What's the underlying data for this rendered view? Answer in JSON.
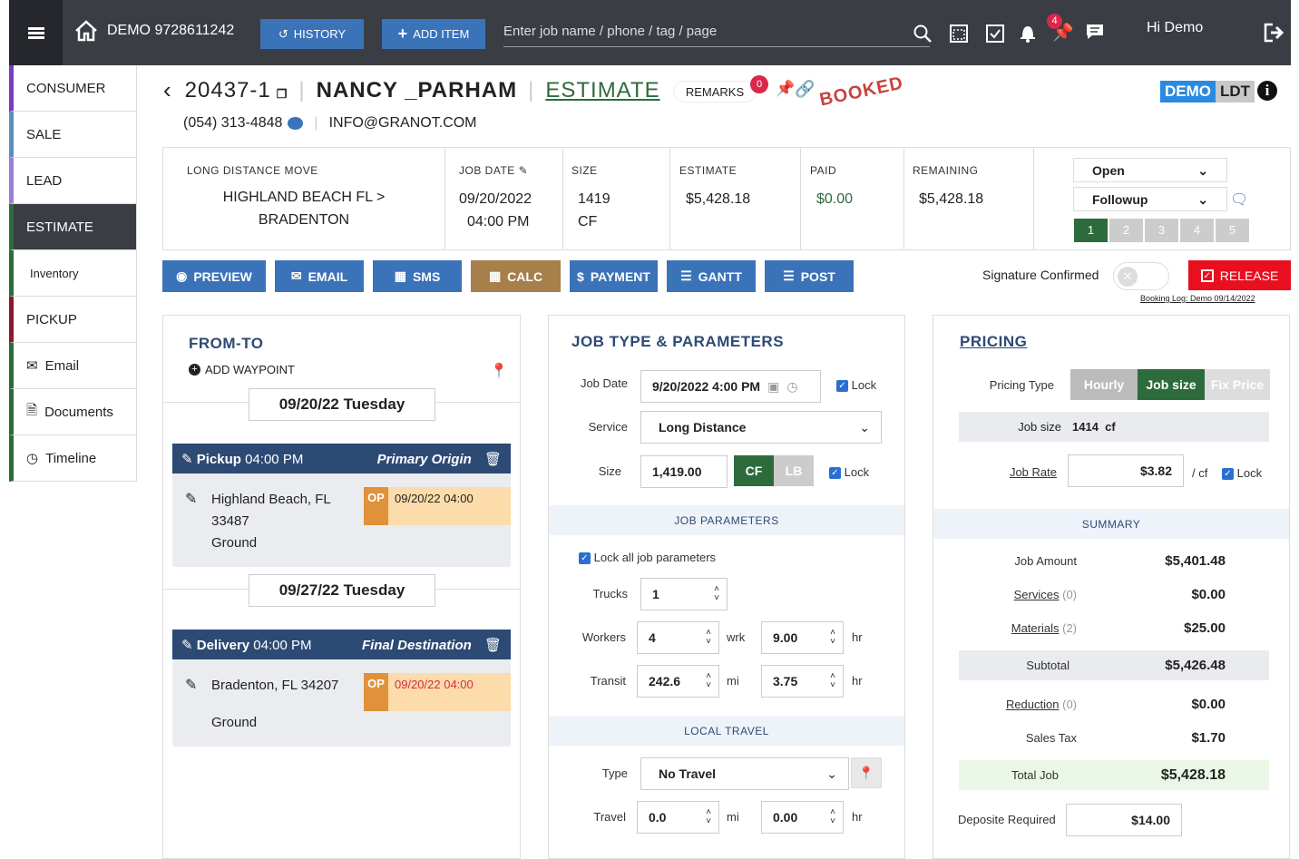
{
  "topbar": {
    "account": "DEMO 9728611242",
    "history_label": "HISTORY",
    "add_item_label": "ADD ITEM",
    "search_placeholder": "Enter job name / phone / tag / page",
    "notif_count": "4",
    "greeting": "Hi Demo"
  },
  "sidebar": {
    "items": [
      {
        "label": "CONSUMER",
        "color": "#7a3bbf"
      },
      {
        "label": "SALE",
        "color": "#5a8fc0"
      },
      {
        "label": "LEAD",
        "color": "#9b7fd4"
      },
      {
        "label": "ESTIMATE",
        "color": "#2e6b3c"
      },
      {
        "label": "Inventory",
        "color": "#2e6b3c"
      },
      {
        "label": "PICKUP",
        "color": "#8a1a2a"
      },
      {
        "label": "Email",
        "color": "#2e6b3c"
      },
      {
        "label": "Documents",
        "color": "#2e6b3c"
      },
      {
        "label": "Timeline",
        "color": "#2e6b3c"
      }
    ]
  },
  "job": {
    "number": "20437-1",
    "name": "NANCY _PARHAM",
    "status": "ESTIMATE",
    "remarks_label": "REMARKS",
    "remarks_count": "0",
    "booked_stamp": "BOOKED",
    "phone": "(054) 313-4848",
    "email": "INFO@GRANOT.COM",
    "badge_demo": "DEMO",
    "badge_ldt": "LDT"
  },
  "summary": {
    "move_type": "LONG DISTANCE MOVE",
    "route_line1": "HIGHLAND BEACH FL >",
    "route_line2": "BRADENTON",
    "job_date_label": "JOB DATE",
    "job_date": "09/20/2022",
    "job_time": "04:00 PM",
    "size_label": "SIZE",
    "size_value": "1419",
    "size_unit": "CF",
    "estimate_label": "ESTIMATE",
    "estimate_value": "$5,428.18",
    "paid_label": "PAID",
    "paid_value": "$0.00",
    "remaining_label": "REMAINING",
    "remaining_value": "$5,428.18",
    "status_select": "Open",
    "followup_select": "Followup",
    "steps": [
      "1",
      "2",
      "3",
      "4",
      "5"
    ]
  },
  "actions": {
    "preview": "PREVIEW",
    "email": "EMAIL",
    "sms": "SMS",
    "calc": "CALC",
    "payment": "PAYMENT",
    "gantt": "GANTT",
    "post": "POST",
    "signature_label": "Signature Confirmed",
    "release": "RELEASE",
    "booking_log": "Booking Log: Demo 09/14/2022"
  },
  "fromto": {
    "title": "FROM-TO",
    "add_waypoint": "ADD WAYPOINT",
    "stops": [
      {
        "date": "09/20/22 Tuesday",
        "type": "Pickup",
        "time": "04:00 PM",
        "role": "Primary Origin",
        "addr1": "Highland Beach, FL",
        "addr2": "33487",
        "level": "Ground",
        "op": "OP",
        "op_time": "09/20/22 04:00"
      },
      {
        "date": "09/27/22 Tuesday",
        "type": "Delivery",
        "time": "04:00 PM",
        "role": "Final Destination",
        "addr1": "Bradenton, FL 34207",
        "addr2": "",
        "level": "Ground",
        "op": "OP",
        "op_time": "09/20/22 04:00"
      }
    ]
  },
  "params": {
    "title": "JOB TYPE & PARAMETERS",
    "job_date_label": "Job Date",
    "job_date_value": "9/20/2022 4:00 PM",
    "lock": "Lock",
    "service_label": "Service",
    "service_value": "Long Distance",
    "size_label": "Size",
    "size_value": "1,419.00",
    "cf": "CF",
    "lb": "LB",
    "section_job": "JOB PARAMETERS",
    "lock_all": "Lock all job parameters",
    "trucks_label": "Trucks",
    "trucks_value": "1",
    "workers_label": "Workers",
    "workers_value": "4",
    "wrk": "wrk",
    "workers_hr": "9.00",
    "hr": "hr",
    "transit_label": "Transit",
    "transit_value": "242.6",
    "mi": "mi",
    "transit_hr": "3.75",
    "section_travel": "LOCAL TRAVEL",
    "type_label": "Type",
    "type_value": "No Travel",
    "travel_label": "Travel",
    "travel_value": "0.0",
    "travel_hr": "0.00"
  },
  "pricing": {
    "title": "PRICING",
    "type_label": "Pricing Type",
    "opt_hourly": "Hourly",
    "opt_jobsize": "Job size",
    "opt_fix": "Fix Price",
    "job_size_label": "Job size",
    "job_size_value": "1414  cf",
    "job_rate_label": "Job Rate",
    "job_rate_value": "$3.82",
    "per_cf": "/ cf",
    "lock": "Lock",
    "summary_title": "SUMMARY",
    "rows": [
      {
        "label": "Job Amount",
        "count": "",
        "value": "$5,401.48"
      },
      {
        "label": "Services",
        "count": "(0)",
        "value": "$0.00"
      },
      {
        "label": "Materials",
        "count": "(2)",
        "value": "$25.00"
      },
      {
        "label": "Subtotal",
        "count": "",
        "value": "$5,426.48"
      },
      {
        "label": "Reduction",
        "count": "(0)",
        "value": "$0.00"
      },
      {
        "label": "Sales Tax",
        "count": "",
        "value": "$1.70"
      },
      {
        "label": "Total Job",
        "count": "",
        "value": "$5,428.18"
      }
    ],
    "deposit_label": "Deposite Required",
    "deposit_value": "$14.00"
  }
}
